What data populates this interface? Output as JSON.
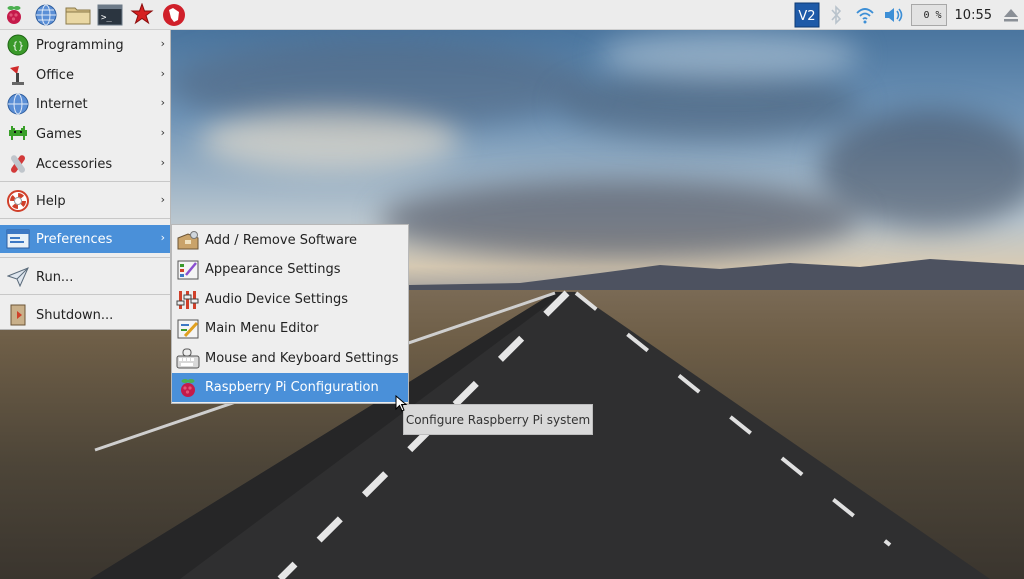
{
  "panel": {
    "launchers": [
      {
        "icon": "raspberry-menu-icon"
      },
      {
        "icon": "web-browser-icon"
      },
      {
        "icon": "file-manager-icon"
      },
      {
        "icon": "terminal-icon"
      },
      {
        "icon": "mathematica-icon"
      },
      {
        "icon": "wolfram-icon"
      }
    ],
    "tray": {
      "vnc_label": "V2",
      "cpu_text": "0 %",
      "clock": "10:55"
    }
  },
  "main_menu": {
    "items": [
      {
        "label": "Programming",
        "icon": "programming-icon",
        "has_submenu": true
      },
      {
        "label": "Office",
        "icon": "office-icon",
        "has_submenu": true
      },
      {
        "label": "Internet",
        "icon": "internet-icon",
        "has_submenu": true
      },
      {
        "label": "Games",
        "icon": "games-icon",
        "has_submenu": true
      },
      {
        "label": "Accessories",
        "icon": "accessories-icon",
        "has_submenu": true
      },
      {
        "label": "Help",
        "icon": "help-icon",
        "has_submenu": true
      },
      {
        "label": "Preferences",
        "icon": "preferences-icon",
        "has_submenu": true,
        "selected": true
      },
      {
        "label": "Run...",
        "icon": "run-icon",
        "has_submenu": false
      },
      {
        "label": "Shutdown...",
        "icon": "shutdown-icon",
        "has_submenu": false
      }
    ],
    "arrow": "›"
  },
  "preferences_submenu": {
    "items": [
      {
        "label": "Add / Remove Software",
        "icon": "package-icon"
      },
      {
        "label": "Appearance Settings",
        "icon": "appearance-icon"
      },
      {
        "label": "Audio Device Settings",
        "icon": "audio-settings-icon"
      },
      {
        "label": "Main Menu Editor",
        "icon": "menu-editor-icon"
      },
      {
        "label": "Mouse and Keyboard Settings",
        "icon": "mouse-keyboard-icon"
      },
      {
        "label": "Raspberry Pi Configuration",
        "icon": "raspberry-config-icon",
        "highlighted": true
      }
    ]
  },
  "tooltip": {
    "text": "Configure Raspberry Pi system"
  },
  "colors": {
    "selection": "#4a90d9",
    "menu_bg": "#eeeeee",
    "panel_bg": "#ececec"
  }
}
